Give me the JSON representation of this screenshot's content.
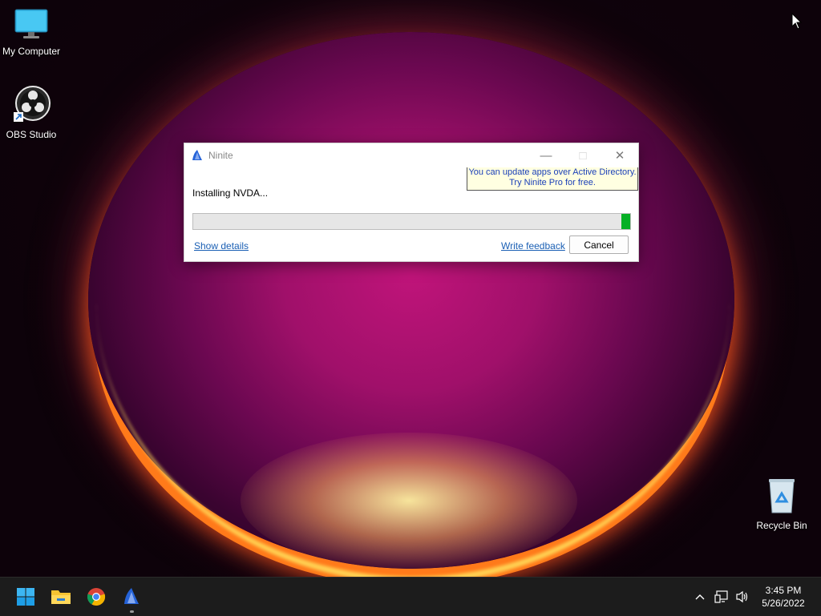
{
  "desktop": {
    "icons": [
      {
        "label": "My Computer",
        "icon": "monitor-icon"
      },
      {
        "label": "OBS Studio",
        "icon": "obs-icon"
      },
      {
        "label": "Recycle Bin",
        "icon": "recycle-bin-icon"
      }
    ]
  },
  "ninite": {
    "title": "Ninite",
    "promo_line1": "You can update apps over Active Directory.",
    "promo_line2": "Try Ninite Pro for free.",
    "status": "Installing NVDA...",
    "progress_fraction": 0.02,
    "show_details": "Show details",
    "write_feedback": "Write feedback",
    "cancel": "Cancel"
  },
  "taskbar": {
    "apps": [
      "start-icon",
      "file-explorer-icon",
      "chrome-icon",
      "ninite-icon"
    ],
    "time": "3:45 PM",
    "date": "5/26/2022"
  },
  "colors": {
    "progress_fill": "#06b025",
    "link": "#1a5fb4",
    "taskbar": "#1c1c1c"
  }
}
